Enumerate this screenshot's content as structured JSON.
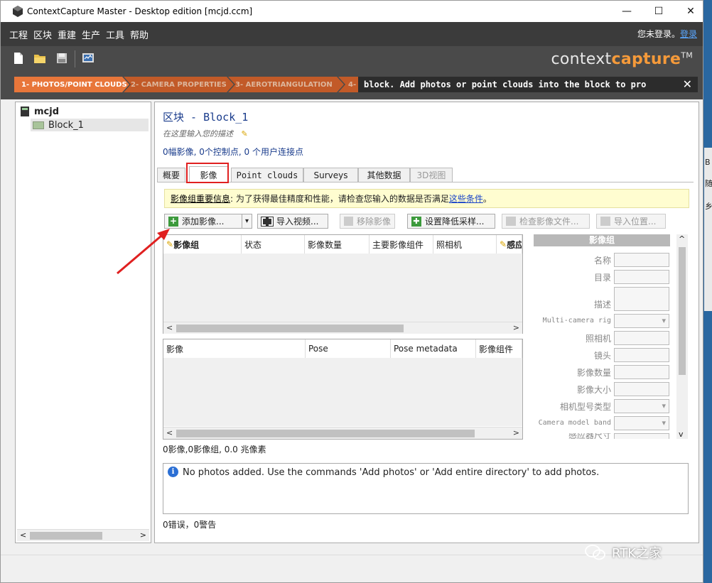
{
  "window": {
    "title": "ContextCapture Master - Desktop edition [mcjd.ccm]",
    "minimize": "—",
    "maximize": "☐",
    "close": "✕"
  },
  "menu": {
    "items": [
      "工程",
      "区块",
      "重建",
      "生产",
      "工具",
      "帮助"
    ],
    "login_text": "您未登录。",
    "login_link": "登录"
  },
  "toolbar": {
    "icons": [
      "new-file-icon",
      "open-folder-icon",
      "save-icon",
      "monitor-icon"
    ]
  },
  "brand": {
    "left": "context",
    "right": "capture",
    "tm": "TM"
  },
  "wizard": {
    "steps": [
      "1- PHOTOS/POINT CLOUDS",
      "2- CAMERA PROPERTIES",
      "3- AEROTRIANGULATION",
      "4-"
    ],
    "tip": "block. Add photos or point clouds into the block to pro",
    "close": "✕"
  },
  "tree": {
    "root": "mcjd",
    "child": "Block_1"
  },
  "block": {
    "title": "区块 - Block_1",
    "description": "在这里输入您的描述",
    "stats": "0幅影像, 0个控制点, 0 个用户连接点"
  },
  "tabs": [
    "概要",
    "影像",
    "Point clouds",
    "Surveys",
    "其他数据",
    "3D视图"
  ],
  "info_bar": {
    "label": "影像组重要信息",
    "text": ": 为了获得最佳精度和性能，请检查您输入的数据是否满足",
    "link": "这些条件",
    "end": "。"
  },
  "buttons": {
    "add_photos": "添加影像...",
    "import_video": "导入视频...",
    "remove_photos": "移除影像",
    "set_downsampling": "设置降低采样...",
    "check_images": "检查影像文件...",
    "import_positions": "导入位置..."
  },
  "photogroup_grid": {
    "columns": [
      "影像组",
      "状态",
      "影像数量",
      "主要影像组件",
      "照相机",
      "感应"
    ]
  },
  "photo_grid": {
    "columns": [
      "影像",
      "Pose",
      "Pose metadata",
      "影像组件"
    ]
  },
  "properties": {
    "header": "影像组",
    "fields": [
      "名称",
      "目录",
      "描述",
      "Multi-camera rig",
      "照相机",
      "镜头",
      "影像数量",
      "影像大小",
      "相机型号类型",
      "Camera model band",
      "感应器尺寸"
    ]
  },
  "summary": "0影像,0影像组, 0.0 兆像素",
  "log": {
    "message": "No photos added. Use the commands 'Add photos' or 'Add entire directory' to add photos."
  },
  "errors": "0错误，0警告",
  "watermark": "RTK之家",
  "desktop_right": [
    "B",
    "随",
    "乡"
  ],
  "colors": {
    "accent_orange": "#e8763a",
    "menu_bg": "#3b3b3b",
    "link_blue": "#1a44c8",
    "highlight_red": "#e02020"
  }
}
